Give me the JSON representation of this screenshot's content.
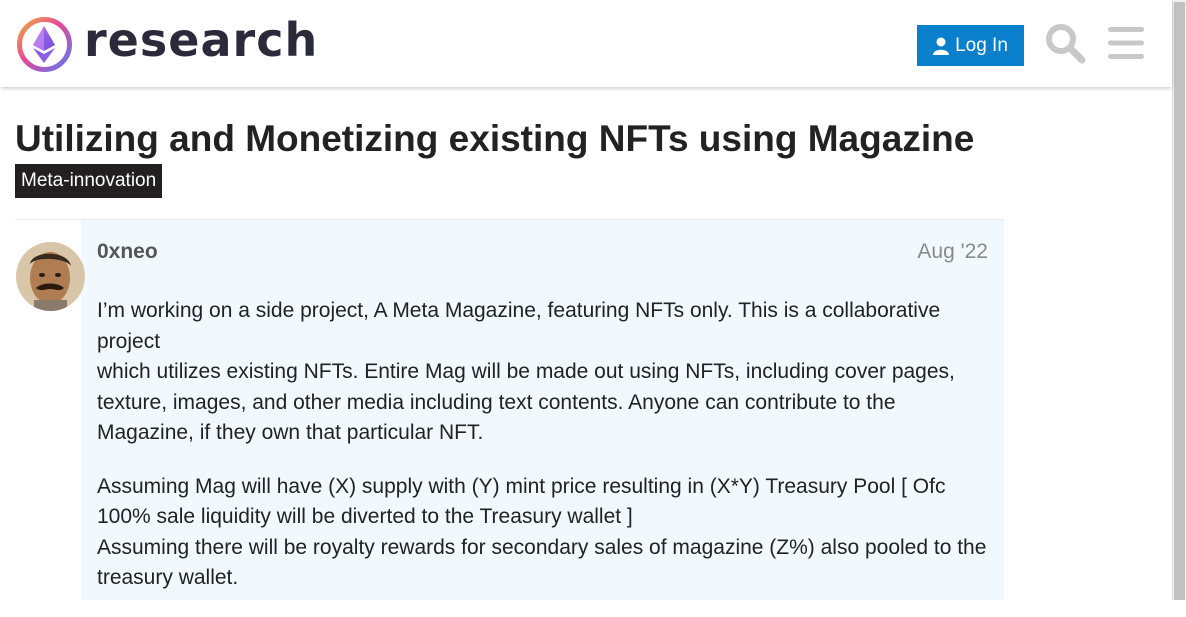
{
  "header": {
    "logo_text": "research",
    "login_label": "Log In",
    "search_icon": "search-icon",
    "menu_icon": "hamburger-menu-icon"
  },
  "topic": {
    "title": "Utilizing and Monetizing existing NFTs using Magazine",
    "category": "Meta-innovation"
  },
  "post": {
    "username": "0xneo",
    "date": "Aug '22",
    "paragraphs": [
      {
        "lines": [
          "I’m working on a side project, A Meta Magazine, featuring NFTs only. This is a collaborative project",
          "which utilizes existing NFTs. Entire Mag will be made out using NFTs, including cover pages, texture, images, and other media including text contents. Anyone can contribute to the Magazine, if they own that particular NFT."
        ]
      },
      {
        "lines": [
          "Assuming Mag will have (X) supply with (Y) mint price resulting in (X*Y) Treasury Pool [ Ofc 100% sale liquidity will be diverted to the Treasury wallet ]",
          "Assuming there will be royalty rewards for secondary sales of magazine (Z%) also pooled to the treasury wallet."
        ]
      }
    ]
  },
  "colors": {
    "accent": "#0a80cc",
    "post_bg": "#f1f8fe",
    "badge_bg": "#231f20"
  }
}
